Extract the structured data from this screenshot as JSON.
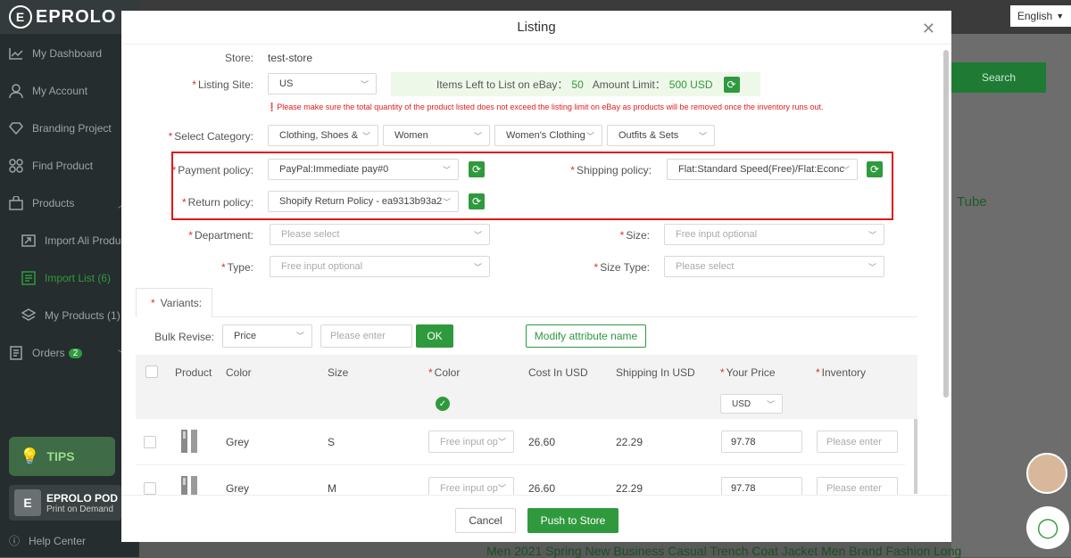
{
  "sidebar": {
    "logo": "EPROLO",
    "items": [
      {
        "label": "My Dashboard",
        "icon": "chart-line-icon"
      },
      {
        "label": "My Account",
        "icon": "user-icon"
      },
      {
        "label": "Branding Project",
        "icon": "diamond-icon"
      },
      {
        "label": "Find Product",
        "icon": "grid-icon"
      },
      {
        "label": "Products",
        "icon": "bag-icon"
      },
      {
        "label": "Import Ali Produc",
        "icon": "import-icon"
      },
      {
        "label": "Import List (6)",
        "icon": "list-icon"
      },
      {
        "label": "My Products (1)",
        "icon": "layers-icon"
      },
      {
        "label": "Orders",
        "icon": "orders-icon",
        "badge": "2"
      }
    ],
    "tips": "TIPS",
    "pod_title": "EPROLO POD",
    "pod_sub": "Print on Demand",
    "help": "Help Center"
  },
  "topbar": {
    "language": "English"
  },
  "background": {
    "search": "Search",
    "tube": "Tube",
    "product_title": "Men 2021 Spring New Business Casual Trench Coat Jacket Men Brand Fashion Long"
  },
  "modal": {
    "title": "Listing",
    "store_label": "Store:",
    "store_value": "test-store",
    "site_label": "Listing Site:",
    "site_value": "US",
    "items_left_label": "Items Left to List on eBay：",
    "items_left_value": "50",
    "amount_limit_label": "Amount Limit：",
    "amount_limit_value": "500 USD",
    "warning": "Please make sure the total quantity of the product listed does not exceed the listing limit on eBay as products will be removed once the inventory runs out.",
    "category_label": "Select Category:",
    "categories": [
      "Clothing, Shoes &",
      "Women",
      "Women's Clothing",
      "Outfits & Sets"
    ],
    "payment_label": "Payment policy:",
    "payment_value": "PayPal:Immediate pay#0",
    "shipping_label": "Shipping policy:",
    "shipping_value": "Flat:Standard Speed(Free)/Flat:Econc",
    "return_label": "Return policy:",
    "return_value": "Shopify Return Policy - ea9313b93a2",
    "department_label": "Department:",
    "department_placeholder": "Please select",
    "size_label": "Size:",
    "size_placeholder": "Free input optional",
    "type_label": "Type:",
    "type_placeholder": "Free input optional",
    "size_type_label": "Size Type:",
    "size_type_placeholder": "Please select",
    "variants_tab": "Variants:",
    "bulk_label": "Bulk Revise:",
    "bulk_select": "Price",
    "bulk_placeholder": "Please enter",
    "ok": "OK",
    "modify_attr": "Modify attribute name",
    "columns": [
      "Product",
      "Color",
      "Size",
      "Color",
      "Cost In USD",
      "Shipping In USD",
      "Your Price",
      "Inventory"
    ],
    "currency": "USD",
    "rows": [
      {
        "color": "Grey",
        "size": "S",
        "color_placeholder": "Free input op",
        "cost": "26.60",
        "shipping": "22.29",
        "price": "97.78",
        "inventory_placeholder": "Please enter"
      },
      {
        "color": "Grey",
        "size": "M",
        "color_placeholder": "Free input op",
        "cost": "26.60",
        "shipping": "22.29",
        "price": "97.78",
        "inventory_placeholder": "Please enter"
      }
    ],
    "cancel": "Cancel",
    "push": "Push to Store"
  },
  "colors": {
    "accent": "#2f9a3d",
    "required": "#e03030",
    "highlight_border": "#e01818"
  }
}
